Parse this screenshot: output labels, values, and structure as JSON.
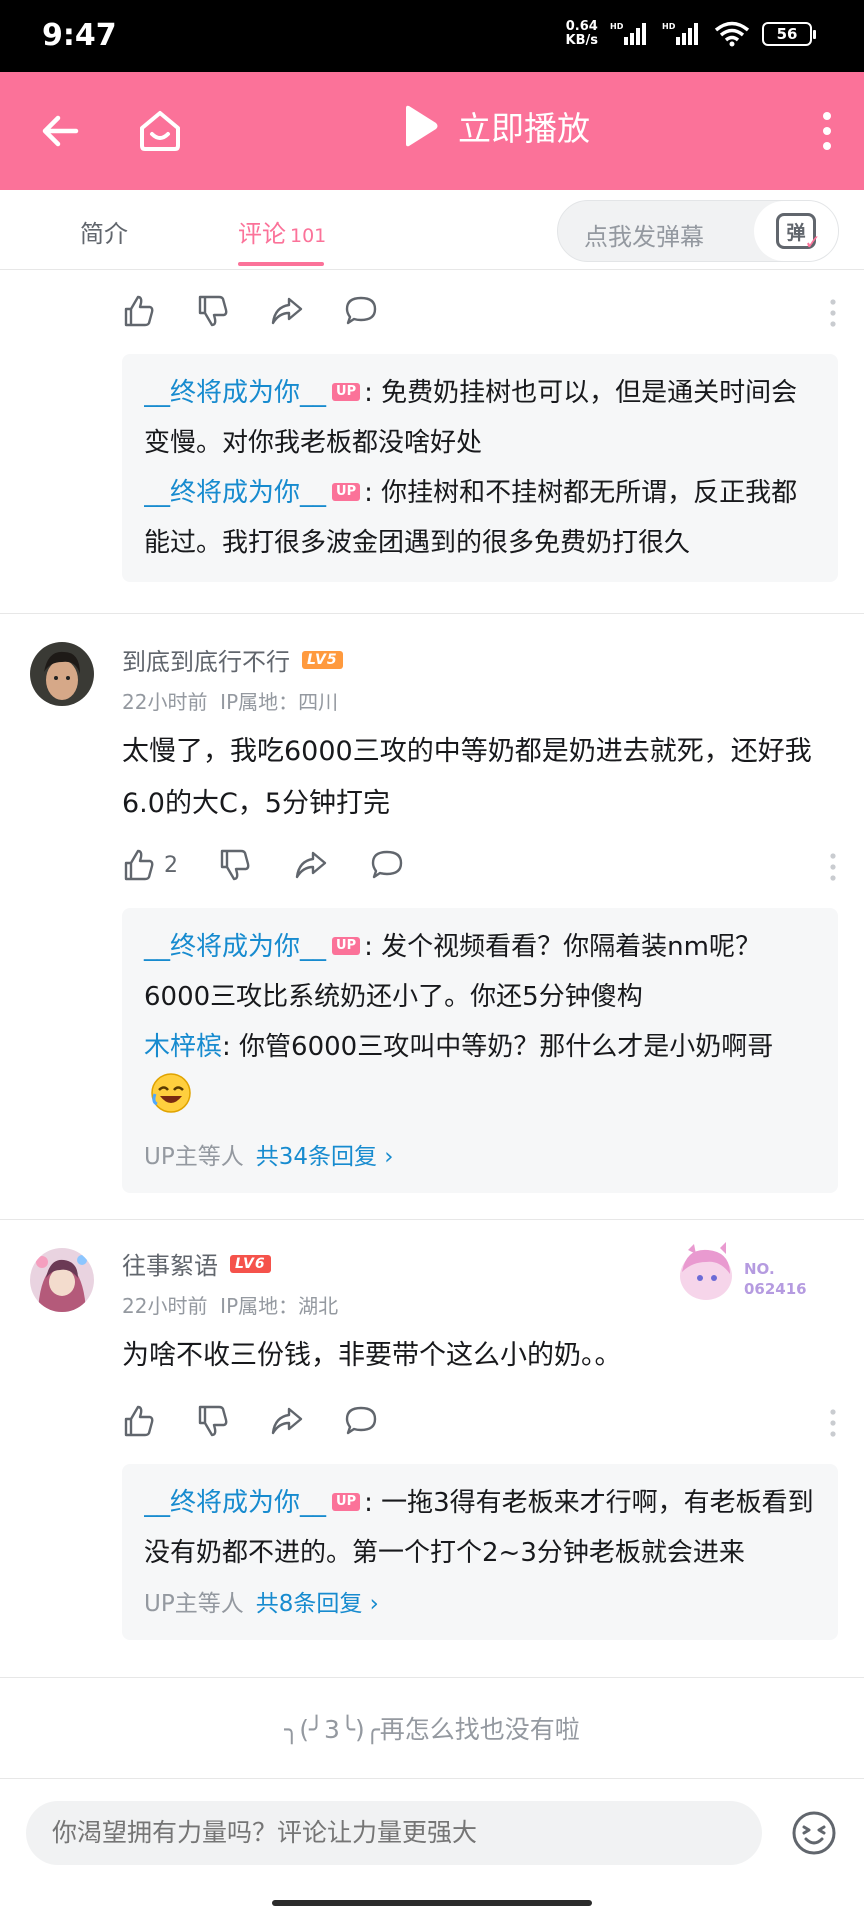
{
  "status_bar": {
    "time": "9:47",
    "net_speed_value": "0.64",
    "net_speed_unit": "KB/s",
    "battery": "56"
  },
  "header": {
    "play_label": "立即播放"
  },
  "tabs": {
    "intro": "简介",
    "comments": "评论",
    "comments_count": "101",
    "danmaku_placeholder": "点我发弹幕",
    "danmaku_icon_char": "弹"
  },
  "comments": [
    {
      "partial": true,
      "replies": [
        {
          "name": "__终将成为你__",
          "up": true,
          "text": ": 免费奶挂树也可以，但是通关时间会变慢。对你我老板都没啥好处"
        },
        {
          "name": "__终将成为你__",
          "up": true,
          "text": ": 你挂树和不挂树都无所谓，反正我都能过。我打很多波金团遇到的很多免费奶打很久"
        }
      ]
    },
    {
      "username": "到底到底行不行",
      "level": "LV5",
      "time": "22小时前",
      "ip": "IP属地：四川",
      "content": "太慢了，我吃6000三攻的中等奶都是奶进去就死，还好我6.0的大C，5分钟打完",
      "likes": "2",
      "replies": [
        {
          "name": "__终将成为你__",
          "up": true,
          "text": ": 发个视频看看？你隔着装nm呢？6000三攻比系统奶还小了。你还5分钟傻构"
        },
        {
          "name": "木梓槟",
          "up": false,
          "text": ": 你管6000三攻叫中等奶？那什么才是小奶啊哥"
        }
      ],
      "reply_summary": "UP主等人",
      "reply_total": "共34条回复 ›"
    },
    {
      "username": "往事絮语",
      "level": "LV6",
      "time": "22小时前",
      "ip": "IP属地：湖北",
      "content": "为啥不收三份钱，非要带个这么小的奶。。",
      "medal_no": "NO.",
      "medal_num": "062416",
      "replies": [
        {
          "name": "__终将成为你__",
          "up": true,
          "text": ": 一拖3得有老板来才行啊，有老板看到没有奶都不进的。第一个打个2~3分钟老板就会进来"
        }
      ],
      "reply_summary": "UP主等人",
      "reply_total": "共8条回复 ›"
    }
  ],
  "end_hint": "╮(╯3╰)╭再怎么找也没有啦",
  "input": {
    "placeholder": "你渴望拥有力量吗？评论让力量更强大"
  },
  "up_tag": "UP"
}
